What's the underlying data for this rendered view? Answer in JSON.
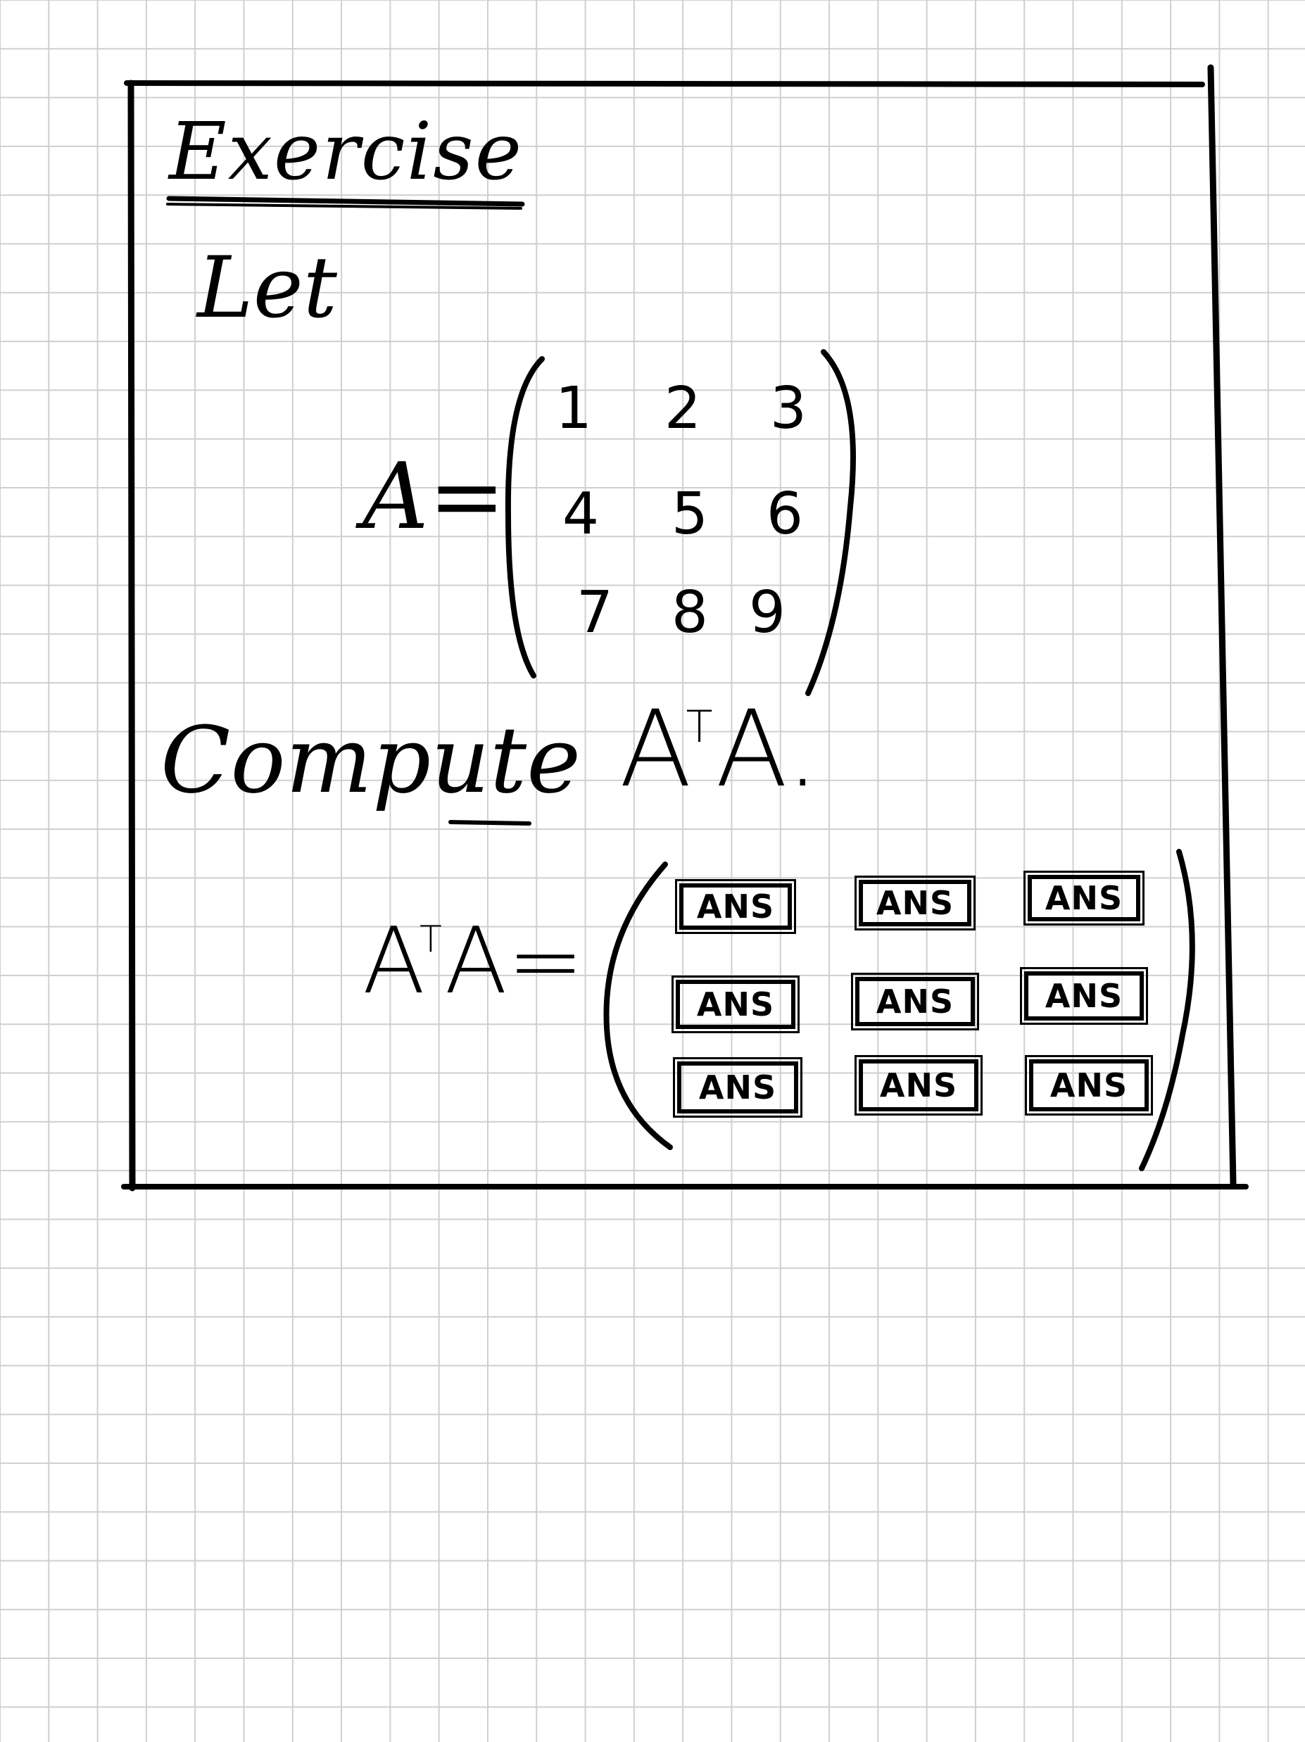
{
  "exercise": {
    "title": "Exercise",
    "intro": "Let",
    "matrix_label": "A=",
    "matrix": [
      [
        "1",
        "2",
        "3"
      ],
      [
        "4",
        "5",
        "6"
      ],
      [
        "7",
        "8",
        "9"
      ]
    ],
    "prompt_label": "Compute",
    "prompt_expression": {
      "base": "A",
      "superscript": "T",
      "tail": "A."
    },
    "result_label": {
      "base": "A",
      "superscript": "T",
      "tail": "A="
    },
    "answer_placeholder": "ANS",
    "answer_grid": [
      [
        "ANS",
        "ANS",
        "ANS"
      ],
      [
        "ANS",
        "ANS",
        "ANS"
      ],
      [
        "ANS",
        "ANS",
        "ANS"
      ]
    ]
  }
}
